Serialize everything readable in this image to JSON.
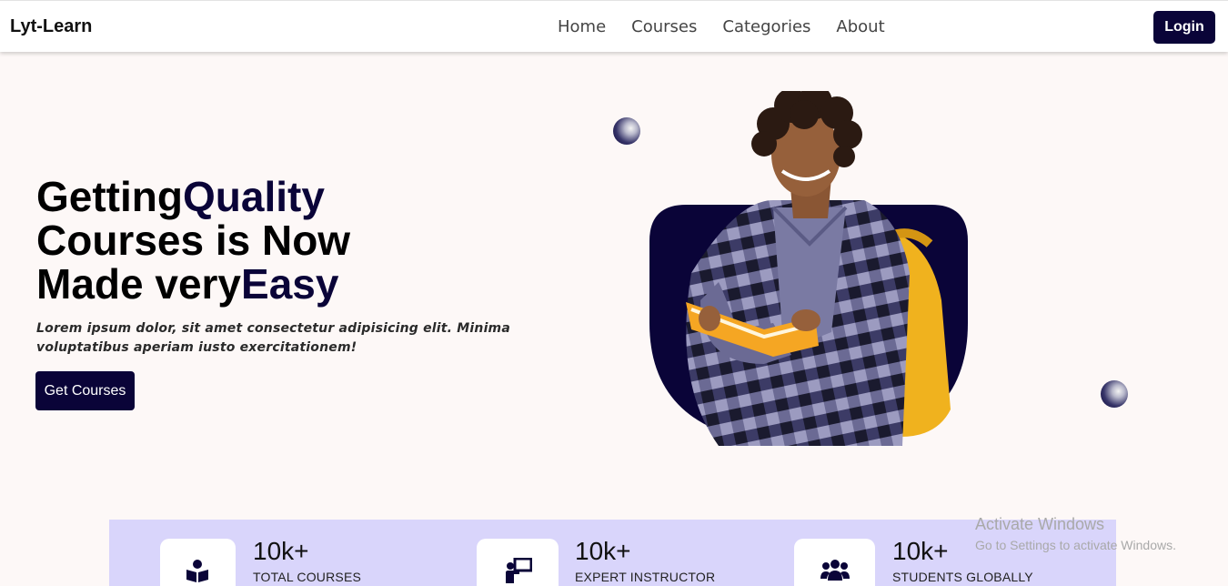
{
  "navbar": {
    "brand": "Lyt-Learn",
    "links": [
      "Home",
      "Courses",
      "Categories",
      "About"
    ],
    "login": "Login"
  },
  "hero": {
    "title_line1_a": "Getting",
    "title_line1_b": "Quality",
    "title_line2": "Courses is Now",
    "title_line3_a": "Made very",
    "title_line3_b": "Easy",
    "text": "Lorem ipsum dolor, sit amet consectetur adipisicing elit. Minima voluptatibus aperiam iusto exercitationem!",
    "cta": "Get Courses"
  },
  "stats": [
    {
      "icon": "book-reader-icon",
      "value": "10k+",
      "label": "TOTAL COURSES"
    },
    {
      "icon": "chalkboard-teacher-icon",
      "value": "10k+",
      "label": "EXPERT INSTRUCTOR"
    },
    {
      "icon": "users-icon",
      "value": "10k+",
      "label": "STUDENTS GLOBALLY"
    }
  ],
  "watermark": {
    "title": "Activate Windows",
    "subtitle": "Go to Settings to activate Windows."
  },
  "colors": {
    "primary": "#0a0438",
    "page_bg": "#fdf8f7",
    "stats_bg": "#d9d5fb",
    "backpack": "#f0b21e"
  }
}
